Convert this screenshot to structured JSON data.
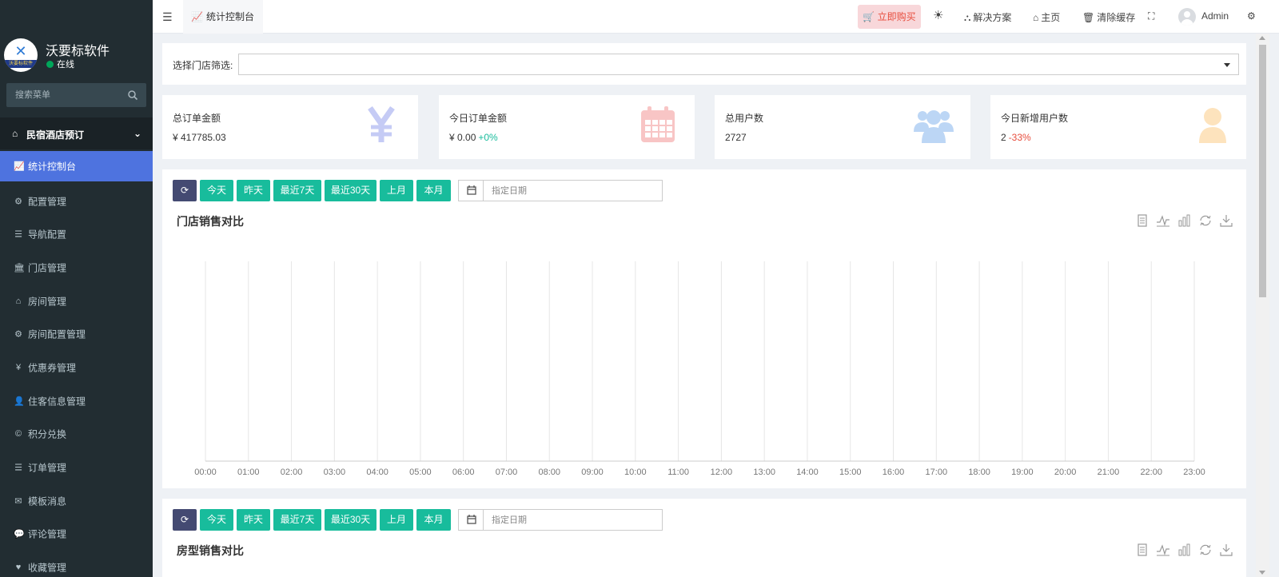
{
  "brand": {
    "name": "沃要标软件",
    "status": "在线",
    "logo_text": "沃要标软件"
  },
  "sidebar": {
    "search_placeholder": "搜索菜单",
    "section_label": "民宿酒店预订",
    "items": [
      {
        "label": "统计控制台",
        "icon": "line-chart-icon",
        "active": true
      },
      {
        "label": "配置管理",
        "icon": "gear-icon"
      },
      {
        "label": "导航配置",
        "icon": "list-icon"
      },
      {
        "label": "门店管理",
        "icon": "bank-icon"
      },
      {
        "label": "房间管理",
        "icon": "home-icon"
      },
      {
        "label": "房间配置管理",
        "icon": "gear-icon"
      },
      {
        "label": "优惠券管理",
        "icon": "yen-icon"
      },
      {
        "label": "住客信息管理",
        "icon": "user-icon"
      },
      {
        "label": "积分兑换",
        "icon": "copyright-icon"
      },
      {
        "label": "订单管理",
        "icon": "list-icon"
      },
      {
        "label": "模板消息",
        "icon": "envelope-icon"
      },
      {
        "label": "评论管理",
        "icon": "comments-icon"
      },
      {
        "label": "收藏管理",
        "icon": "heart-icon"
      }
    ]
  },
  "topbar": {
    "tab_label": "统计控制台",
    "buy_label": "立即购买",
    "solutions_label": "解决方案",
    "home_label": "主页",
    "clear_cache_label": "清除缓存",
    "user_name": "Admin"
  },
  "filter": {
    "label": "选择门店筛选:"
  },
  "stats": [
    {
      "title": "总订单金额",
      "value": "¥ 417785.03",
      "change": "",
      "icon": "yen-icon",
      "color": "#c5cbf5"
    },
    {
      "title": "今日订单金额",
      "value": "¥ 0.00",
      "change": "+0%",
      "trend": "up",
      "icon": "calendar-icon",
      "color": "#f8c5c5"
    },
    {
      "title": "总用户数",
      "value": "2727",
      "change": "",
      "icon": "users-icon",
      "color": "#bcd6f5"
    },
    {
      "title": "今日新增用户数",
      "value": "2",
      "change": "-33%",
      "trend": "down",
      "icon": "user-icon",
      "color": "#fde3bd"
    }
  ],
  "range_buttons": [
    "今天",
    "昨天",
    "最近7天",
    "最近30天",
    "上月",
    "本月"
  ],
  "date_placeholder": "指定日期",
  "charts": {
    "store_sales": {
      "title": "门店销售对比"
    },
    "room_type_sales": {
      "title": "房型销售对比"
    }
  },
  "chart_data": {
    "type": "line",
    "title": "门店销售对比",
    "categories": [
      "00:00",
      "01:00",
      "02:00",
      "03:00",
      "04:00",
      "05:00",
      "06:00",
      "07:00",
      "08:00",
      "09:00",
      "10:00",
      "11:00",
      "12:00",
      "13:00",
      "14:00",
      "15:00",
      "16:00",
      "17:00",
      "18:00",
      "19:00",
      "20:00",
      "21:00",
      "22:00",
      "23:00"
    ],
    "series": [],
    "grid": true
  },
  "colors": {
    "sidebar_bg": "#222d32",
    "active_bg": "#4e73df",
    "accent": "#18bc9c",
    "refresh_btn": "#444a72",
    "buy_bg": "#f8d7da",
    "buy_text": "#e74c3c"
  }
}
